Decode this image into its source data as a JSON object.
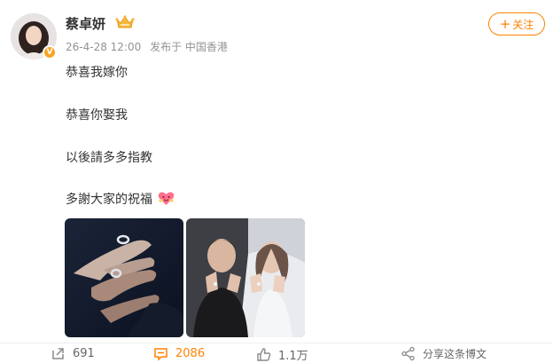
{
  "user": {
    "name": "蔡卓妍",
    "badge_icon": "crown-icon",
    "verified_icon": "v-badge"
  },
  "meta": {
    "date": "26-4-28 12:00",
    "source": "发布于 中国香港"
  },
  "follow_label": "关注",
  "follow_plus": "+",
  "content": {
    "line1": "恭喜我嫁你",
    "line2": "恭喜你娶我",
    "line3": "以後請多多指教",
    "line4": "多謝大家的祝福"
  },
  "photos": [
    {
      "name": "hands-rings-photo"
    },
    {
      "name": "couple-wedding-photo"
    }
  ],
  "footer": {
    "repost_count": "691",
    "comment_count": "2086",
    "like_count": "1.1万",
    "share_label": "分享这条博文"
  },
  "colors": {
    "accent": "#ff8200",
    "text": "#333333",
    "meta": "#939393"
  }
}
